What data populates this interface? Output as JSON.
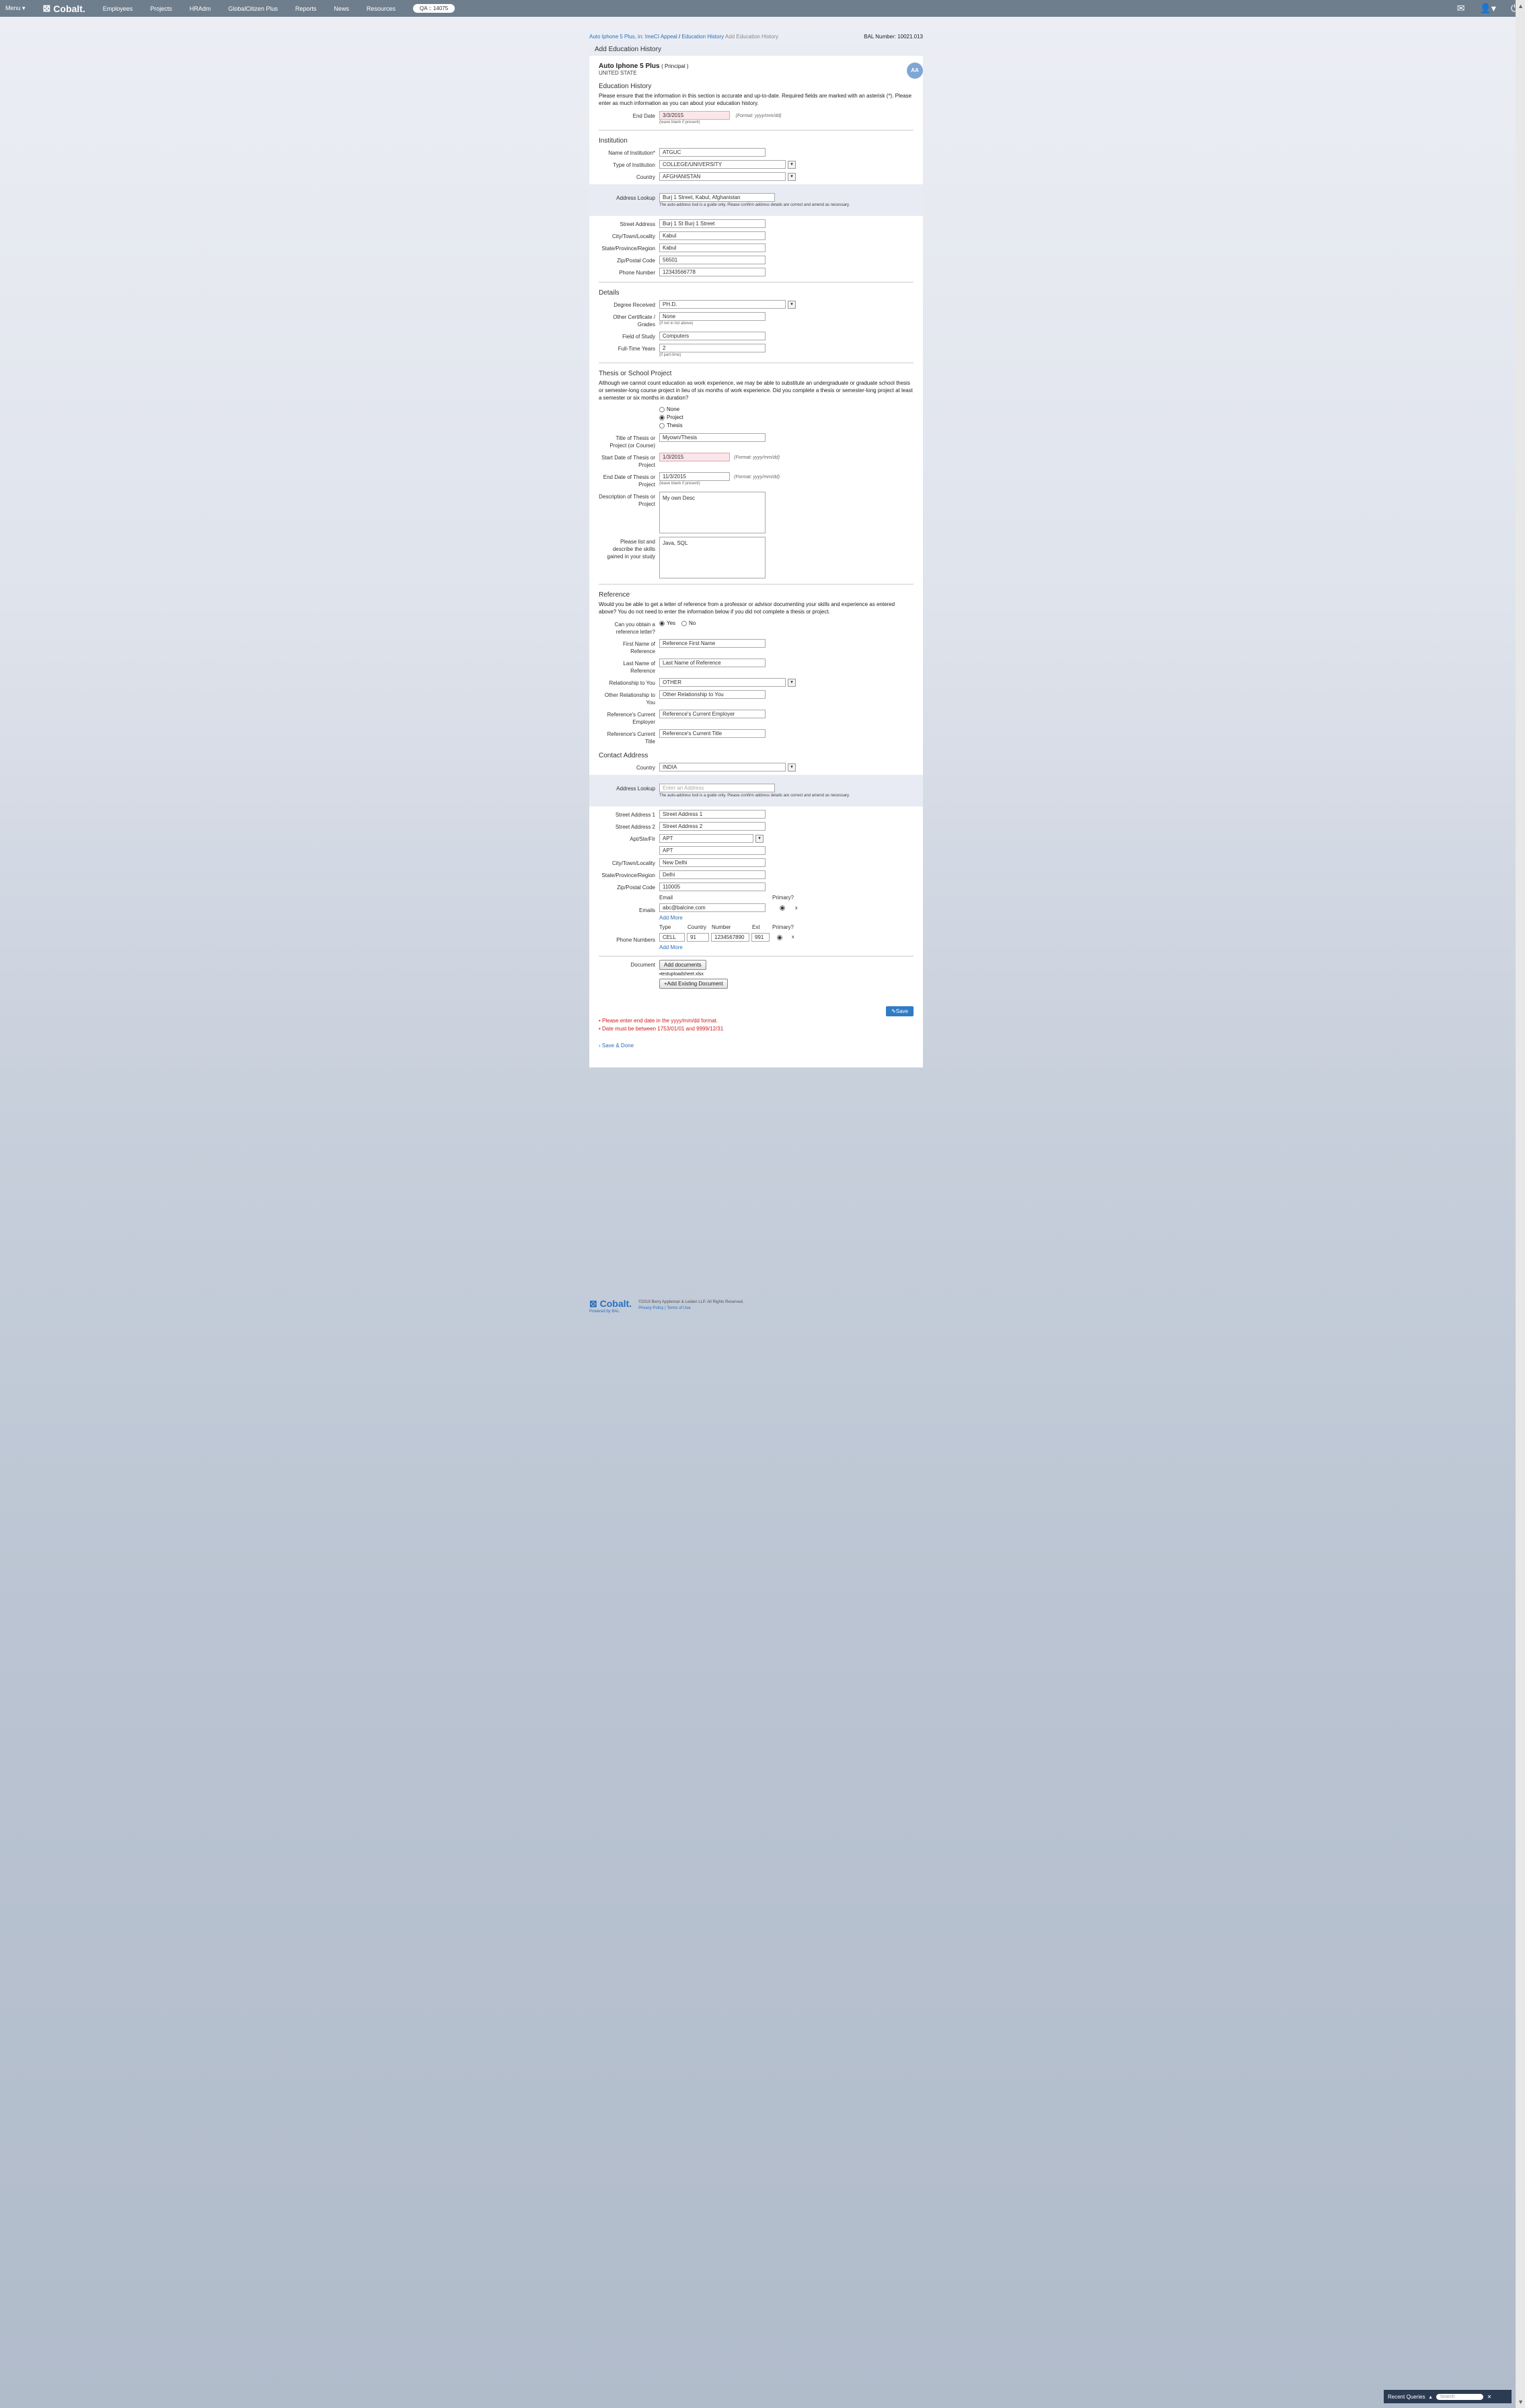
{
  "topbar": {
    "menu": "Menu",
    "brand": "Cobalt.",
    "nav": [
      "Employees",
      "Projects",
      "HRAdm",
      "GlobalCitizen Plus",
      "Reports",
      "News",
      "Resources"
    ],
    "env": "QA :: 14075"
  },
  "breadcrumb": {
    "link": "Auto Iphone 5 Plus, in: ImeCI Appeal",
    "section": "Education History",
    "current": "Add Education History",
    "bal": "BAL Number: 10021.013"
  },
  "panel_title": "Add Education History",
  "person": {
    "name": "Auto Iphone 5 Plus",
    "role": "( Principal )",
    "country": "UNITED STATE",
    "badge": "AA"
  },
  "education": {
    "heading": "Education History",
    "intro": "Please ensure that the information in this section is accurate and up-to-date. Required fields are marked with an asterisk (*). Please enter as much information as you can about your education history.",
    "end_date_label": "End Date",
    "end_date": "3/3/2015",
    "end_date_hint": "(Format: yyyy/mm/dd)",
    "end_date_sub": "(leave blank if present)"
  },
  "institution": {
    "heading": "Institution",
    "name_label": "Name of Institution*",
    "name": "ATGUC",
    "type_label": "Type of Institution",
    "type": "COLLEGE/UNIVERSITY",
    "country_label": "Country",
    "country": "AFGHANISTAN",
    "lookup_label": "Address Lookup",
    "lookup": "Burj 1 Street, Kabul, Afghanistan",
    "lookup_note": "The auto-address tool is a guide only. Please confirm address details are correct and amend as necessary.",
    "street_label": "Street Address",
    "street": "Burj 1 St Burj 1 Street",
    "city_label": "City/Town/Locality",
    "city": "Kabul",
    "state_label": "State/Province/Region",
    "state": "Kabul",
    "zip_label": "Zip/Postal Code",
    "zip": "56501",
    "phone_label": "Phone Number",
    "phone": "12343566778"
  },
  "details": {
    "heading": "Details",
    "degree_label": "Degree Received",
    "degree": "PH.D.",
    "other_cert_label": "Other Certificate / Grades",
    "other_cert": "None",
    "other_cert_sub": "(if not in list above)",
    "field_label": "Field of Study",
    "field": "Computers",
    "years_label": "Full-Time Years",
    "years": "2",
    "years_sub": "(if part-time)"
  },
  "thesis": {
    "heading": "Thesis or School Project",
    "intro": "Although we cannot count education as work experience, we may be able to substitute an undergraduate or graduate school thesis or semester-long course project in lieu of six months of work experience. Did you complete a thesis or semester-long project at least a semester or six months in duration?",
    "options": [
      "None",
      "Project",
      "Thesis"
    ],
    "title_label": "Title of Thesis or Project (or Course)",
    "title": "Myown/Thesis",
    "start_label": "Start Date of Thesis or Project",
    "start": "1/3/2015",
    "start_hint": "(Format: yyyy/mm/dd)",
    "end_label": "End Date of Thesis or Project",
    "end": "11/3/2015",
    "end_hint": "(Format: yyyy/mm/dd)",
    "end_sub": "(leave blank if present)",
    "desc_label": "Description of Thesis or Project",
    "desc": "My own Desc",
    "skills_label": "Please list and describe the skills gained in your study",
    "skills": "Java, SQL"
  },
  "reference": {
    "heading": "Reference",
    "intro": "Would you be able to get a letter of reference from a professor or advisor documenting your skills and experience as entered above? You do not need to enter the information below if you did not complete a thesis or project.",
    "obtain_label": "Can you obtain a reference letter?",
    "yes": "Yes",
    "no": "No",
    "first_label": "First Name of Reference",
    "first": "Reference First Name",
    "last_label": "Last Name of Reference",
    "last": "Last Name of Reference",
    "rel_label": "Relationship to You",
    "rel": "OTHER",
    "other_rel_label": "Other Relationship to You",
    "other_rel": "Other Relationship to You",
    "employer_label": "Reference's Current Employer",
    "employer": "Reference's Current Employer",
    "title_label": "Reference's Current Title",
    "title": "Reference's Current Title"
  },
  "contact": {
    "heading": "Contact Address",
    "country_label": "Country",
    "country": "INDIA",
    "lookup_label": "Address Lookup",
    "lookup_placeholder": "Enter an Address",
    "lookup_note": "The auto-address tool is a guide only. Please confirm address details are correct and amend as necessary.",
    "street1_label": "Street Address 1",
    "street1": "Street Address 1",
    "street2_label": "Street Address 2",
    "street2": "Street Address 2",
    "apt_label": "Apt/Ste/Flr",
    "apt_select": "APT",
    "apt": "APT",
    "city_label": "City/Town/Locality",
    "city": "New Delhi",
    "state_label": "State/Province/Region",
    "state": "Delhi",
    "zip_label": "Zip/Postal Code",
    "zip": "110005",
    "emails_label": "Emails",
    "email_col": "Email",
    "primary_col": "Primary?",
    "email": "abc@balcine.com",
    "add_more": "Add More",
    "phones_label": "Phone Numbers",
    "phone_cols": [
      "Type",
      "Country",
      "Number",
      "Ext",
      "Primary?"
    ],
    "phone_type": "CELL",
    "phone_country": "91",
    "phone_number": "1234567890",
    "phone_ext": "991",
    "add_more_phone": "Add More"
  },
  "documents": {
    "label": "Document",
    "add": "Add documents",
    "file": "testuploadsheet.xlsx",
    "existing": "Add Existing Document"
  },
  "actions": {
    "save": "Save",
    "save_close": "Save & Done"
  },
  "errors": [
    "Please enter end date in the yyyy/mm/dd format.",
    "Date must be between 1753/01/01 and 9999/12/31"
  ],
  "footer": {
    "brand": "Cobalt.",
    "tag": "Powered by BAL",
    "copyright": "©2019 Berry Appleman & Leiden LLP. All Rights Reserved.",
    "links": "Privacy Policy | Terms of Use"
  },
  "recent_queries": {
    "label": "Recent Queries",
    "placeholder": "Search"
  }
}
